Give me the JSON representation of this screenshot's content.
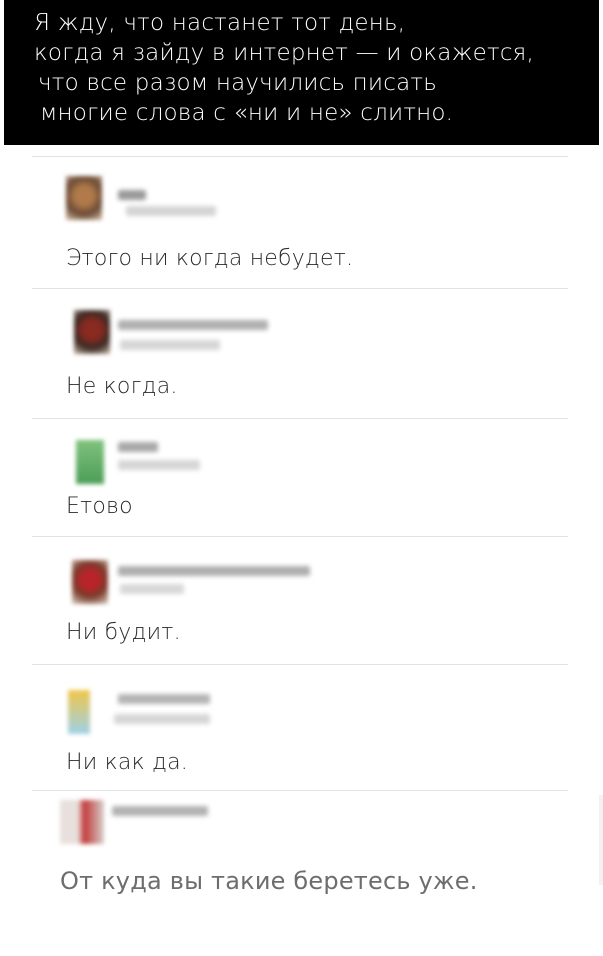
{
  "caption": {
    "line1": "Я жду, что настанет тот день,",
    "line2": "когда я зайду в интернет — и окажется,",
    "line3": "что все разом научились писать",
    "line4": "многие слова с «ни и не» слитно."
  },
  "comments": [
    {
      "text": "Этого ни когда небудет."
    },
    {
      "text": "Не когда."
    },
    {
      "text": "Етово"
    },
    {
      "text": "Ни будит."
    },
    {
      "text": "Ни как да."
    },
    {
      "text": "От куда вы такие беретесь уже."
    }
  ],
  "colors": {
    "caption_bg": "#000000",
    "caption_text": "#ffffff",
    "comment_text": "#2a2a2a",
    "last_comment_text": "#6d6d6d"
  }
}
